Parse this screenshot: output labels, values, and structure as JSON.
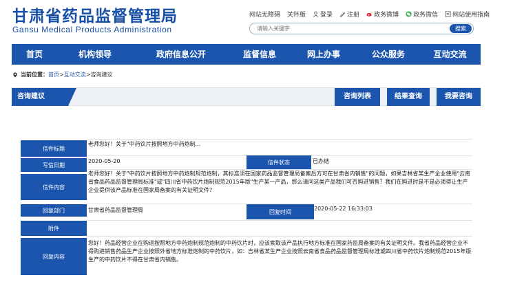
{
  "header": {
    "title": "甘肃省药品监督管理局",
    "subtitle": "Gansu Medical Products Administration",
    "links": [
      {
        "label": "网站无障碍",
        "icon": ""
      },
      {
        "label": "关怀版",
        "icon": ""
      },
      {
        "label": "登录",
        "icon": "user-icon"
      },
      {
        "label": "注册",
        "icon": "edit-icon"
      },
      {
        "label": "政务微博",
        "icon": "weibo-icon"
      },
      {
        "label": "政务微信",
        "icon": "wechat-icon"
      },
      {
        "label": "网站使用指南",
        "icon": "guide-icon"
      }
    ],
    "search_placeholder": "请输入关键字",
    "search_button": "搜索"
  },
  "nav": [
    "首页",
    "机构领导",
    "政府信息公开",
    "监督信息",
    "网上办事",
    "公众服务",
    "互动交流"
  ],
  "breadcrumb": {
    "prefix": "当前位置：",
    "items": [
      "首页",
      ">",
      "互动交流",
      ">",
      "咨询建议"
    ]
  },
  "section": {
    "title": "咨询建议",
    "buttons": [
      "咨询列表",
      "结果查询",
      "我要咨询"
    ]
  },
  "form": {
    "subject_label": "信件标题",
    "subject_value": "老师您好！关于\"中药饮片按照地方中药炮制...",
    "date_label": "写信日期",
    "date_value": "2020-05-20",
    "status_label": "信件状态",
    "status_value": "已办结",
    "content_label": "信件内容",
    "content_value": "老师您好！关于\"中药饮片按照地方中药炮制规范炮制，其标准须在国家药品监督管理局备案后方可在甘肃省内销售\"的问题，如果吉林省某生产企业使用\"云南省食品药品监督管理局标准\"或\"四川省中药饮片炮制规范2015年版\"生产某一产品，那么请问这类产品我们可否购进销售？我们在购进时是不是必须得让生产企业提供该产品标准在国家局备案的有关证明文件？",
    "dept_label": "回复部门",
    "dept_value": "甘肃省药品监督管理局",
    "reply_time_label": "回复时间",
    "reply_time_value": "2020-05-22 16:33:03",
    "attachment_label": "附件",
    "reply_label": "回复内容",
    "reply_value": "您好！药品经营企业在购进按照地方中药炮制规范炮制的中药饮片时，应该索取该产品执行地方标准在国家药监局备案的有关证明文件。我省药品经营企业不得购进销售药品生产企业按照外省地方标准炮制的中药饮片，如：吉林省某生产企业按照云南省食品药品监督管理局标准或四川省中药饮片炮制规范2015年版生产的中药饮片不得在甘肃省内销售。"
  },
  "colors": {
    "brand": "#1c55ad",
    "bar_bg": "#eef1f6"
  }
}
